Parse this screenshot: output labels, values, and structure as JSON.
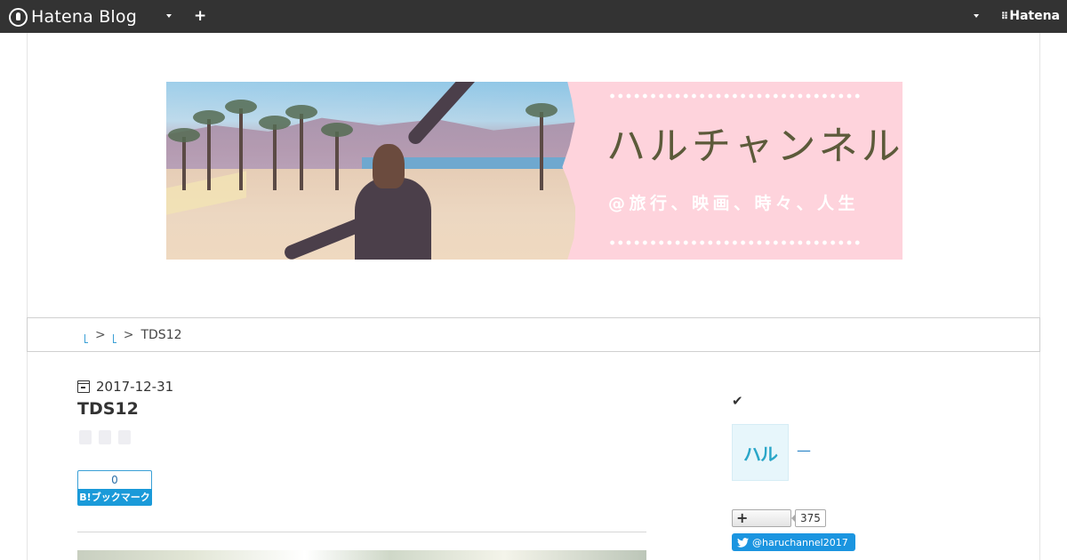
{
  "topbar": {
    "logo_text": "Hatena Blog",
    "brand_text": "Hatena",
    "colors": {
      "background": "#333333",
      "foreground": "#ffffff"
    },
    "icons": [
      "hatena-logo-icon",
      "chevron-down-icon",
      "plus-icon",
      "hatena-brand-icon"
    ]
  },
  "banner": {
    "title": "ハルチャンネル",
    "subtitle": "@旅行、映画、時々、人生",
    "colors": {
      "panel": "#fed3dc",
      "title": "#5c5a3a",
      "subtitle": "#ffffff"
    }
  },
  "breadcrumb": {
    "separator": ">",
    "current": "TDS12"
  },
  "entry": {
    "date": "2017-12-31",
    "title": "TDS12",
    "bookmark_count": "0",
    "bookmark_label": "B!ブックマーク"
  },
  "sidebar": {
    "avatar_text": "ハル",
    "author_link": "—",
    "follow_count": "375",
    "twitter_handle": "@haruchannel2017",
    "colors": {
      "twitter": "#1b95e0",
      "link": "#2a84c7"
    }
  }
}
